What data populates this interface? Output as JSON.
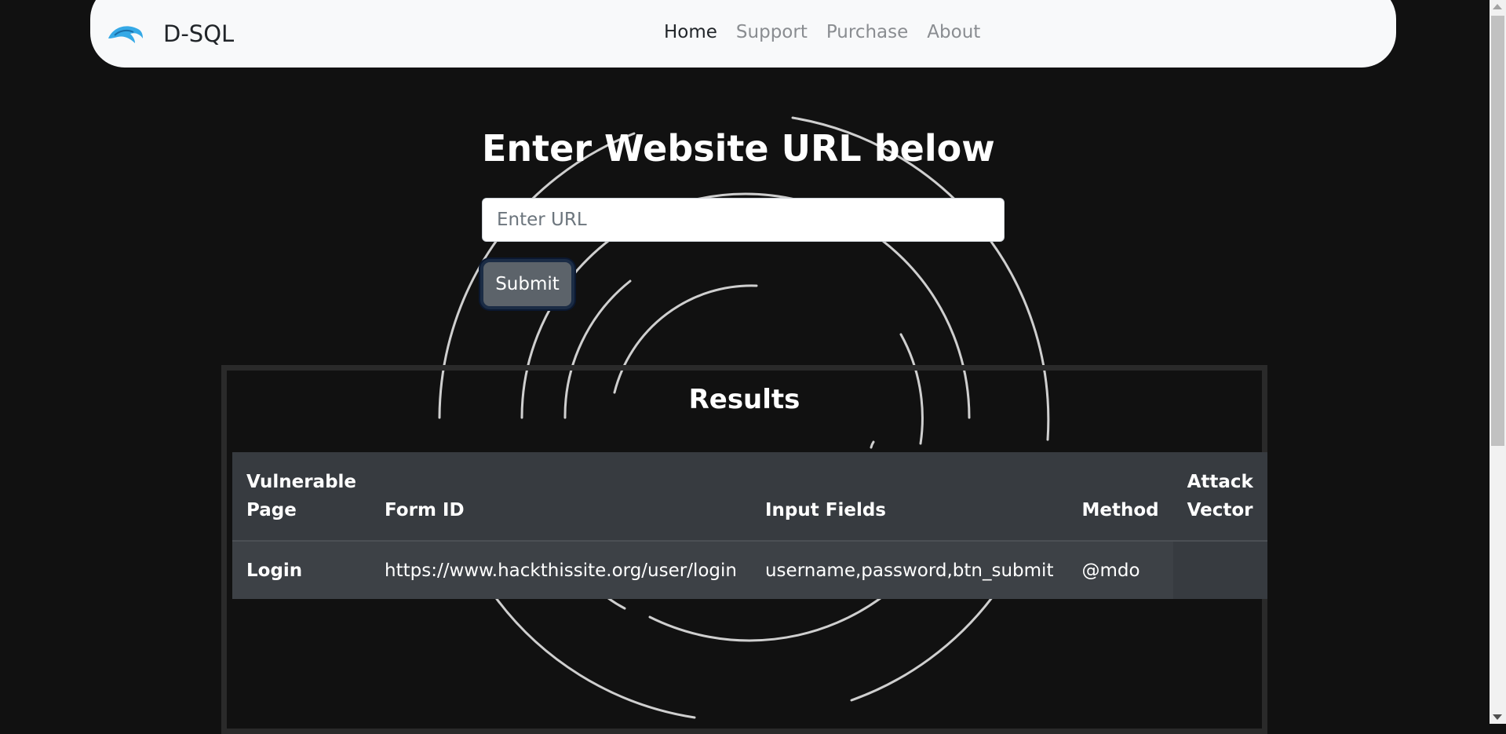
{
  "navbar": {
    "brand": "D-SQL",
    "links": [
      "Home",
      "Support",
      "Purchase",
      "About"
    ],
    "active": "Home"
  },
  "main": {
    "heading": "Enter Website URL below",
    "url_placeholder": "Enter URL",
    "url_value": "",
    "submit_label": "Submit"
  },
  "results": {
    "title": "Results",
    "columns": [
      "Vulnerable Page",
      "Form ID",
      "Input Fields",
      "Method",
      "Attack Vector"
    ],
    "rows": [
      {
        "vulnerable_page": "Login",
        "form_id": "https://www.hackthissite.org/user/login",
        "input_fields": "username,password,btn_submit",
        "method": "@mdo",
        "attack_vector": ""
      }
    ]
  },
  "colors": {
    "background": "#111111",
    "navbar": "#f8f9fa",
    "table_header": "#373b40",
    "table_row": "#3d4146",
    "button": "#5c636a",
    "logo_accent": "#35a9e6"
  }
}
